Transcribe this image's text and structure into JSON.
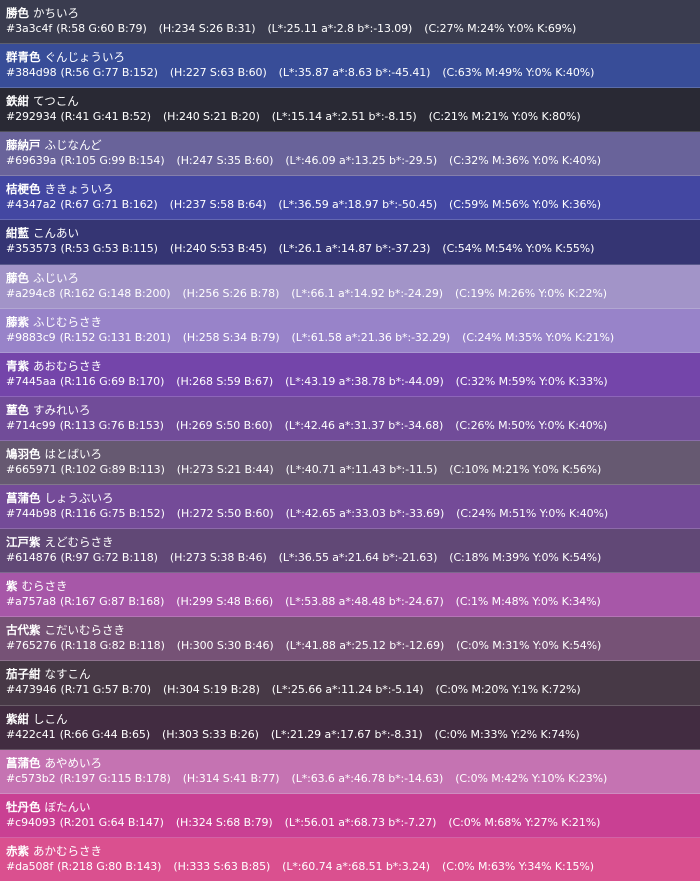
{
  "colors": [
    {
      "kanji": "勝色",
      "kana": "かちいろ",
      "hex": "#3a3c4f",
      "rgb": "(R:58 G:60 B:79)",
      "hsb": "(H:234 S:26 B:31)",
      "lab": "(L*:25.11 a*:2.8 b*:-13.09)",
      "cmyk": "(C:27% M:24% Y:0% K:69%)"
    },
    {
      "kanji": "群青色",
      "kana": "ぐんじょういろ",
      "hex": "#384d98",
      "rgb": "(R:56 G:77 B:152)",
      "hsb": "(H:227 S:63 B:60)",
      "lab": "(L*:35.87 a*:8.63 b*:-45.41)",
      "cmyk": "(C:63% M:49% Y:0% K:40%)"
    },
    {
      "kanji": "鉄紺",
      "kana": "てつこん",
      "hex": "#292934",
      "rgb": "(R:41 G:41 B:52)",
      "hsb": "(H:240 S:21 B:20)",
      "lab": "(L*:15.14 a*:2.51 b*:-8.15)",
      "cmyk": "(C:21% M:21% Y:0% K:80%)"
    },
    {
      "kanji": "藤納戸",
      "kana": "ふじなんど",
      "hex": "#69639a",
      "rgb": "(R:105 G:99 B:154)",
      "hsb": "(H:247 S:35 B:60)",
      "lab": "(L*:46.09 a*:13.25 b*:-29.5)",
      "cmyk": "(C:32% M:36% Y:0% K:40%)"
    },
    {
      "kanji": "桔梗色",
      "kana": "ききょういろ",
      "hex": "#4347a2",
      "rgb": "(R:67 G:71 B:162)",
      "hsb": "(H:237 S:58 B:64)",
      "lab": "(L*:36.59 a*:18.97 b*:-50.45)",
      "cmyk": "(C:59% M:56% Y:0% K:36%)"
    },
    {
      "kanji": "紺藍",
      "kana": "こんあい",
      "hex": "#353573",
      "rgb": "(R:53 G:53 B:115)",
      "hsb": "(H:240 S:53 B:45)",
      "lab": "(L*:26.1 a*:14.87 b*:-37.23)",
      "cmyk": "(C:54% M:54% Y:0% K:55%)"
    },
    {
      "kanji": "藤色",
      "kana": "ふじいろ",
      "hex": "#a294c8",
      "rgb": "(R:162 G:148 B:200)",
      "hsb": "(H:256 S:26 B:78)",
      "lab": "(L*:66.1 a*:14.92 b*:-24.29)",
      "cmyk": "(C:19% M:26% Y:0% K:22%)"
    },
    {
      "kanji": "藤紫",
      "kana": "ふじむらさき",
      "hex": "#9883c9",
      "rgb": "(R:152 G:131 B:201)",
      "hsb": "(H:258 S:34 B:79)",
      "lab": "(L*:61.58 a*:21.36 b*:-32.29)",
      "cmyk": "(C:24% M:35% Y:0% K:21%)"
    },
    {
      "kanji": "青紫",
      "kana": "あおむらさき",
      "hex": "#7445aa",
      "rgb": "(R:116 G:69 B:170)",
      "hsb": "(H:268 S:59 B:67)",
      "lab": "(L*:43.19 a*:38.78 b*:-44.09)",
      "cmyk": "(C:32% M:59% Y:0% K:33%)"
    },
    {
      "kanji": "菫色",
      "kana": "すみれいろ",
      "hex": "#714c99",
      "rgb": "(R:113 G:76 B:153)",
      "hsb": "(H:269 S:50 B:60)",
      "lab": "(L*:42.46 a*:31.37 b*:-34.68)",
      "cmyk": "(C:26% M:50% Y:0% K:40%)"
    },
    {
      "kanji": "鳩羽色",
      "kana": "はとばいろ",
      "hex": "#665971",
      "rgb": "(R:102 G:89 B:113)",
      "hsb": "(H:273 S:21 B:44)",
      "lab": "(L*:40.71 a*:11.43 b*:-11.5)",
      "cmyk": "(C:10% M:21% Y:0% K:56%)"
    },
    {
      "kanji": "菖蒲色",
      "kana": "しょうぶいろ",
      "hex": "#744b98",
      "rgb": "(R:116 G:75 B:152)",
      "hsb": "(H:272 S:50 B:60)",
      "lab": "(L*:42.65 a*:33.03 b*:-33.69)",
      "cmyk": "(C:24% M:51% Y:0% K:40%)"
    },
    {
      "kanji": "江戸紫",
      "kana": "えどむらさき",
      "hex": "#614876",
      "rgb": "(R:97 G:72 B:118)",
      "hsb": "(H:273 S:38 B:46)",
      "lab": "(L*:36.55 a*:21.64 b*:-21.63)",
      "cmyk": "(C:18% M:39% Y:0% K:54%)"
    },
    {
      "kanji": "紫",
      "kana": "むらさき",
      "hex": "#a757a8",
      "rgb": "(R:167 G:87 B:168)",
      "hsb": "(H:299 S:48 B:66)",
      "lab": "(L*:53.88 a*:48.48 b*:-24.67)",
      "cmyk": "(C:1% M:48% Y:0% K:34%)"
    },
    {
      "kanji": "古代紫",
      "kana": "こだいむらさき",
      "hex": "#765276",
      "rgb": "(R:118 G:82 B:118)",
      "hsb": "(H:300 S:30 B:46)",
      "lab": "(L*:41.88 a*:25.12 b*:-12.69)",
      "cmyk": "(C:0% M:31% Y:0% K:54%)"
    },
    {
      "kanji": "茄子紺",
      "kana": "なすこん",
      "hex": "#473946",
      "rgb": "(R:71 G:57 B:70)",
      "hsb": "(H:304 S:19 B:28)",
      "lab": "(L*:25.66 a*:11.24 b*:-5.14)",
      "cmyk": "(C:0% M:20% Y:1% K:72%)"
    },
    {
      "kanji": "紫紺",
      "kana": "しこん",
      "hex": "#422c41",
      "rgb": "(R:66 G:44 B:65)",
      "hsb": "(H:303 S:33 B:26)",
      "lab": "(L*:21.29 a*:17.67 b*:-8.31)",
      "cmyk": "(C:0% M:33% Y:2% K:74%)"
    },
    {
      "kanji": "菖蒲色",
      "kana": "あやめいろ",
      "hex": "#c573b2",
      "rgb": "(R:197 G:115 B:178)",
      "hsb": "(H:314 S:41 B:77)",
      "lab": "(L*:63.6 a*:46.78 b*:-14.63)",
      "cmyk": "(C:0% M:42% Y:10% K:23%)"
    },
    {
      "kanji": "牡丹色",
      "kana": "ぼたんい",
      "hex": "#c94093",
      "rgb": "(R:201 G:64 B:147)",
      "hsb": "(H:324 S:68 B:79)",
      "lab": "(L*:56.01 a*:68.73 b*:-7.27)",
      "cmyk": "(C:0% M:68% Y:27% K:21%)"
    },
    {
      "kanji": "赤紫",
      "kana": "あかむらさき",
      "hex": "#da508f",
      "rgb": "(R:218 G:80 B:143)",
      "hsb": "(H:333 S:63 B:85)",
      "lab": "(L*:60.74 a*:68.51 b*:3.24)",
      "cmyk": "(C:0% M:63% Y:34% K:15%)"
    }
  ]
}
